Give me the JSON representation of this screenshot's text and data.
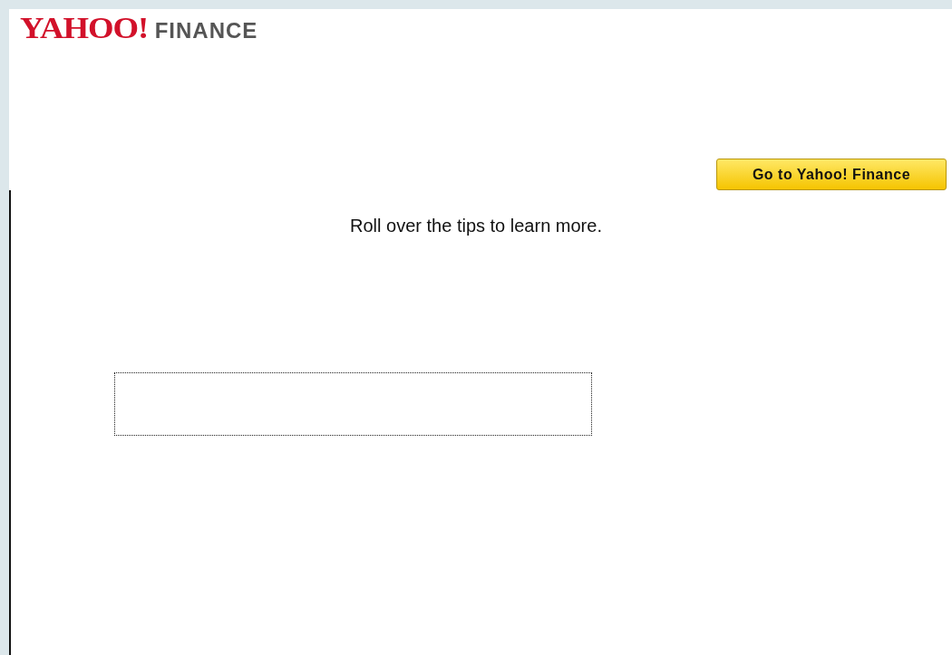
{
  "logo": {
    "brand": "YAHOO!",
    "section": "FINANCE"
  },
  "button": {
    "label": "Go to Yahoo! Finance"
  },
  "instruction": "Roll over the tips to learn more."
}
